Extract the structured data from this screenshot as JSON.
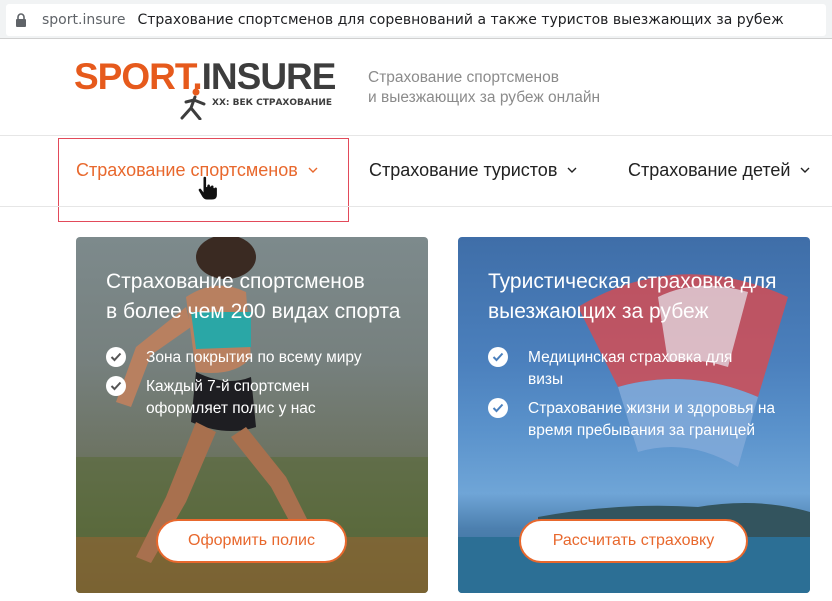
{
  "browser": {
    "host": "sport.insure",
    "title": "Страхование спортсменов для соревнований а также туристов выезжающих за рубеж"
  },
  "header": {
    "logo_sport": "SPORT",
    "logo_insure": "INSURE",
    "logo_subtitle": "XX: ВЕК СТРАХОВАНИЕ",
    "tagline_line1": "Страхование спортсменов",
    "tagline_line2": "и выезжающих за рубеж онлайн"
  },
  "nav": {
    "items": [
      {
        "label": "Страхование спортсменов",
        "active": true
      },
      {
        "label": "Страхование туристов",
        "active": false
      },
      {
        "label": "Страхование детей",
        "active": false
      }
    ]
  },
  "cards": [
    {
      "title_line1": "Страхование спортсменов",
      "title_line2": "в более чем 200 видах спорта",
      "bullets": [
        "Зона покрытия по всему миру",
        "Каждый 7-й спортсмен оформляет полис у нас"
      ],
      "button": "Оформить полис"
    },
    {
      "title_line1": "Туристическая страховка для",
      "title_line2": "выезжающих за рубеж",
      "bullets": [
        "Медицинская страховка для визы",
        "Страхование жизни и здоровья на время пребывания за границей"
      ],
      "button": "Рассчитать страховку"
    }
  ],
  "colors": {
    "accent": "#e8682d",
    "highlight": "#e24a5a",
    "logo_orange": "#e65a1c",
    "logo_dark": "#3d3d3d"
  }
}
